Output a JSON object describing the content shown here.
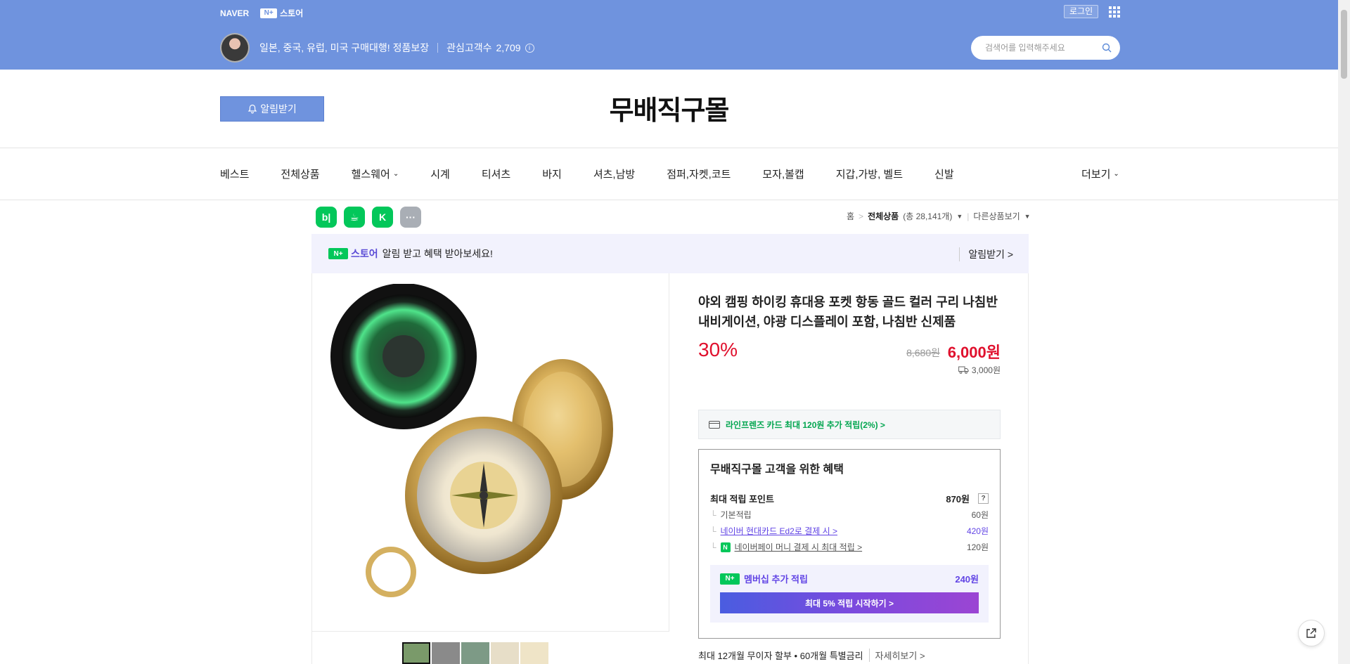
{
  "gnb": {
    "naver": "NAVER",
    "nplus_box": "N+",
    "nplus_label": "스토어",
    "login": "로그인"
  },
  "store": {
    "description": "일본, 중국, 유럽, 미국 구매대행! 정품보장",
    "fans_label": "관심고객수",
    "fans_count": "2,709",
    "search_placeholder": "검색어를 입력해주세요",
    "alarm_button": "알림받기",
    "name": "무배직구몰"
  },
  "nav": {
    "items": [
      "베스트",
      "전체상품",
      "헬스웨어",
      "시계",
      "티셔츠",
      "바지",
      "셔츠,남방",
      "점퍼,자켓,코트",
      "모자,볼캡",
      "지갑,가방, 벨트",
      "신발"
    ],
    "dropdown_item": "헬스웨어",
    "more": "더보기"
  },
  "share": {
    "blog": "b|",
    "cafe": "☕",
    "keep": "K",
    "more": "···"
  },
  "breadcrumb": {
    "home": "홈",
    "sep": ">",
    "category": "전체상품",
    "count": "(총 28,141개)",
    "other": "다른상품보기"
  },
  "banner": {
    "brand_box": "N+",
    "brand": "스토어",
    "message": "알림 받고 혜택 받아보세요!",
    "subscribe": "알림받기 >"
  },
  "product": {
    "title": "야외 캠핑 하이킹 휴대용 포켓 항동 골드 컬러 구리 나침반 내비게이션, 야광 디스플레이 포함, 나침반 신제품",
    "discount": "30%",
    "original_price": "8,680원",
    "price": "6,000원",
    "shipping": "3,000원",
    "card_benefit": "라인프렌즈 카드 최대 120원 추가 적립(2%) >"
  },
  "benefit": {
    "title": "무배직구몰 고객을 위한 혜택",
    "max_point_label": "최대 적립 포인트",
    "max_point_value": "870원",
    "rows": [
      {
        "label": "기본적립",
        "value": "60원"
      },
      {
        "label": "네이버 현대카드 Ed2로 결제 시 >",
        "value": "420원"
      },
      {
        "label": "네이버페이 머니 결제 시 최대 적립 >",
        "value": "120원"
      }
    ],
    "membership_label": "멤버십 추가 적립",
    "membership_value": "240원",
    "cta": "최대 5% 적립 시작하기 >"
  },
  "installment": {
    "text": "최대 12개월 무이자 할부 • 60개월 특별금리",
    "detail": "자세히보기 >"
  },
  "colors": {
    "brand_blue": "#6f93de",
    "price_red": "#e0102d",
    "naver_green": "#03c75a",
    "purple": "#6144e5"
  }
}
